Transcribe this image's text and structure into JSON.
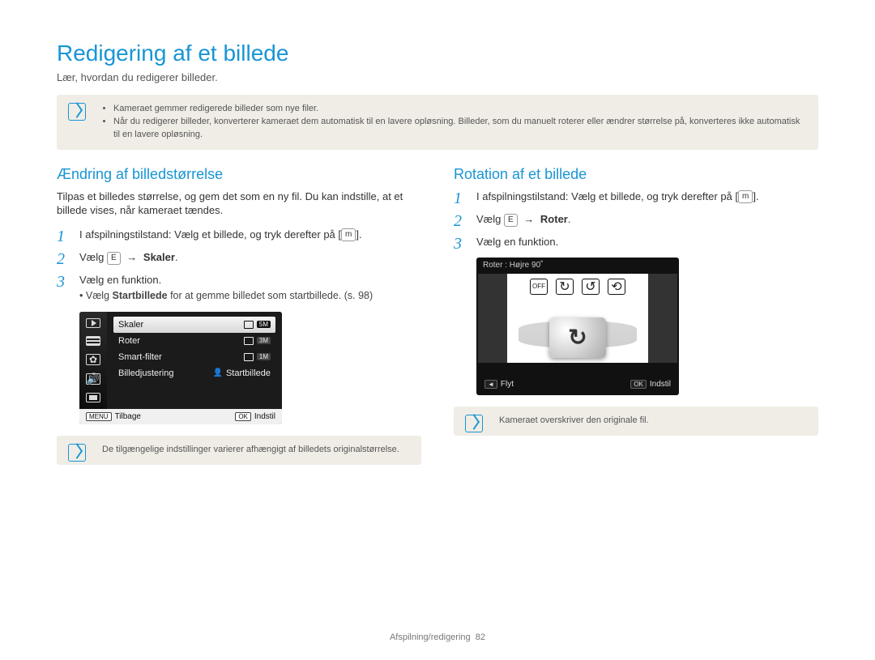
{
  "page": {
    "title": "Redigering af et billede",
    "subtitle": "Lær, hvordan du redigerer billeder."
  },
  "topnote": {
    "line1": "Kameraet gemmer redigerede billeder som nye filer.",
    "line2": "Når du redigerer billeder, konverterer kameraet dem automatisk til en lavere opløsning. Billeder, som du manuelt roterer eller ændrer størrelse på, konverteres ikke automatisk til en lavere opløsning."
  },
  "left": {
    "heading": "Ændring af billedstørrelse",
    "lead": "Tilpas et billedes størrelse, og gem det som en ny fil. Du kan indstille, at et billede vises, når kameraet tændes.",
    "step1": "I afspilningstilstand: Vælg et billede, og tryk derefter på",
    "step1_btn": "m",
    "step2_pre": "Vælg",
    "step2_btn": "E",
    "step2_arrow": "→",
    "step2_post": "Skaler",
    "step3": "Vælg en funktion.",
    "step3_sub_a": "Vælg ",
    "step3_sub_b": "Startbillede",
    "step3_sub_c": " for at gemme billedet som startbillede. (s. 98)",
    "menu": {
      "rows": [
        {
          "label": "Skaler",
          "value_badge": "5M"
        },
        {
          "label": "Roter",
          "value_badge": "3M"
        },
        {
          "label": "Smart-filter",
          "value_badge": "1M"
        },
        {
          "label": "Billedjustering",
          "value_icon": "person",
          "value_text": "Startbillede"
        }
      ],
      "footer_left_key": "MENU",
      "footer_left_lbl": "Tilbage",
      "footer_right_key": "OK",
      "footer_right_lbl": "Indstil"
    },
    "note": "De tilgængelige indstillinger varierer afhængigt af billedets originalstørrelse."
  },
  "right": {
    "heading": "Rotation af et billede",
    "step1": "I afspilningstilstand: Vælg et billede, og tryk derefter på",
    "step1_btn": "m",
    "step2_pre": "Vælg",
    "step2_btn": "E",
    "step2_arrow": "→",
    "step2_post": "Roter",
    "step3": "Vælg en funktion.",
    "preview": {
      "top_label": "Roter : Højre 90˚",
      "footer_left_sym": "◄",
      "footer_left_lbl": "Flyt",
      "footer_right_key": "OK",
      "footer_right_lbl": "Indstil"
    },
    "note": "Kameraet overskriver den originale fil."
  },
  "footer": {
    "section": "Afspilning/redigering",
    "page": "82"
  }
}
